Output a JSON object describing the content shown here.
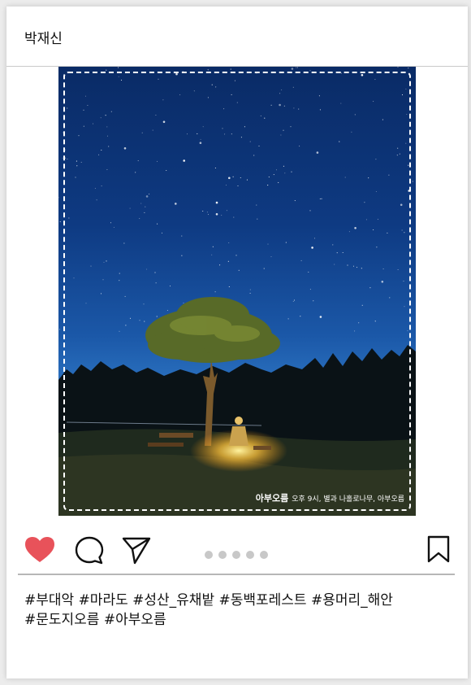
{
  "post": {
    "username": "박재신",
    "photo_caption": {
      "brand": "아부오름",
      "text": "오후 9시, 별과 나홀로나무, 아부오름"
    },
    "carousel": {
      "total": 5
    },
    "hashtags": [
      "#부대악 #마라도 #성산_유채밭 #동백포레스트 #용머리_해안",
      "#문도지오름 #아부오름"
    ]
  },
  "colors": {
    "like": "#e8525a",
    "sky_top": "#0a2b66",
    "sky_horizon": "#3a7fc4"
  },
  "icons": {
    "like": "heart-icon",
    "comment": "comment-icon",
    "share": "send-icon",
    "save": "bookmark-icon"
  }
}
